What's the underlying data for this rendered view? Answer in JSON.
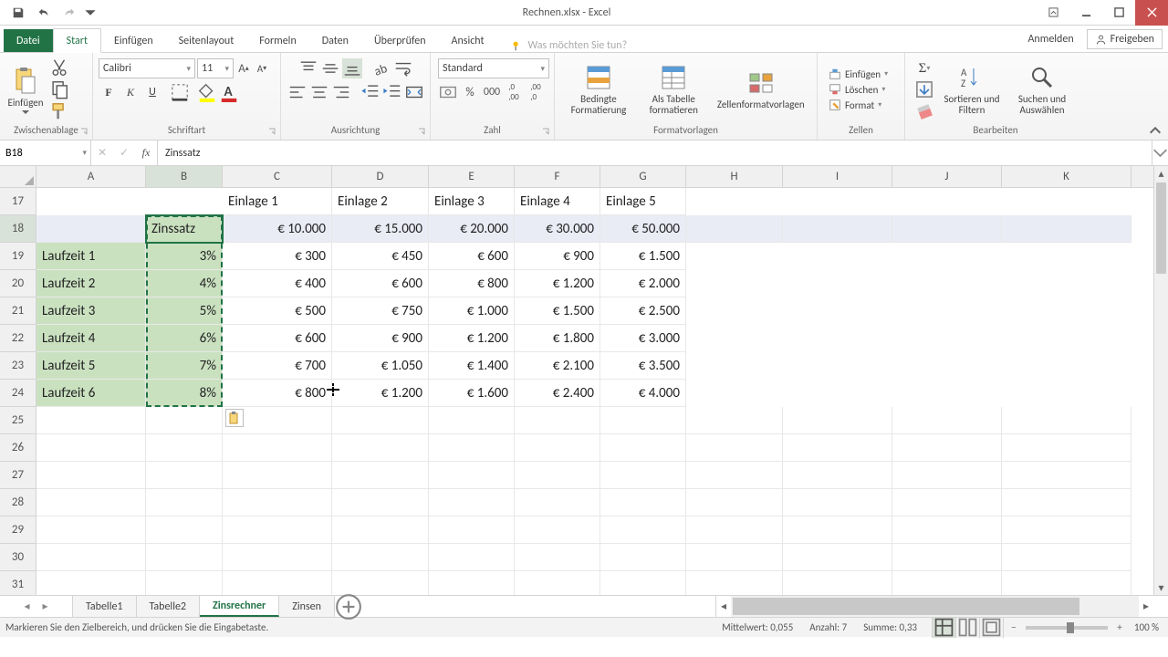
{
  "title": "Rechnen.xlsx - Excel",
  "ribbon_tabs": {
    "file": "Datei",
    "start": "Start",
    "einfuegen": "Einfügen",
    "seitenlayout": "Seitenlayout",
    "formeln": "Formeln",
    "daten": "Daten",
    "ueberpruefen": "Überprüfen",
    "ansicht": "Ansicht"
  },
  "tellme_placeholder": "Was möchten Sie tun?",
  "signin": "Anmelden",
  "share": "Freigeben",
  "groups": {
    "zwischenablage": "Zwischenablage",
    "schriftart": "Schriftart",
    "ausrichtung": "Ausrichtung",
    "zahl": "Zahl",
    "formatvorlagen": "Formatvorlagen",
    "zellen": "Zellen",
    "bearbeiten": "Bearbeiten"
  },
  "paste_label": "Einfügen",
  "font_name": "Calibri",
  "font_size": "11",
  "number_format": "Standard",
  "cond_format_label": "Bedingte Formatierung",
  "table_format_label": "Als Tabelle formatieren",
  "cell_styles_label": "Zellenformatvorlagen",
  "insert_label": "Einfügen",
  "delete_label": "Löschen",
  "format_label": "Format",
  "sort_filter_label": "Sortieren und Filtern",
  "find_select_label": "Suchen und Auswählen",
  "namebox": "B18",
  "formula": "Zinssatz",
  "columns": {
    "A": "A",
    "B": "B",
    "C": "C",
    "D": "D",
    "E": "E",
    "F": "F",
    "G": "G",
    "H": "H",
    "I": "I",
    "J": "J",
    "K": "K"
  },
  "col_widths": {
    "A": 120,
    "B": 84,
    "C": 120,
    "D": 106,
    "E": 94,
    "F": 94,
    "G": 94,
    "H": 106,
    "I": 120,
    "J": 120,
    "K": 142
  },
  "rows": [
    "17",
    "18",
    "19",
    "20",
    "21",
    "22",
    "23",
    "24",
    "25",
    "26",
    "27",
    "28",
    "29",
    "30",
    "31"
  ],
  "data": {
    "header_row": {
      "C": "Einlage 1",
      "D": "Einlage 2",
      "E": "Einlage 3",
      "F": "Einlage 4",
      "G": "Einlage 5"
    },
    "r18": {
      "B": "Zinssatz",
      "C": "€ 10.000",
      "D": "€ 15.000",
      "E": "€ 20.000",
      "F": "€ 30.000",
      "G": "€ 50.000"
    },
    "body": [
      {
        "A": "Laufzeit 1",
        "B": "3%",
        "C": "€ 300",
        "D": "€ 450",
        "E": "€ 600",
        "F": "€ 900",
        "G": "€ 1.500"
      },
      {
        "A": "Laufzeit 2",
        "B": "4%",
        "C": "€ 400",
        "D": "€ 600",
        "E": "€ 800",
        "F": "€ 1.200",
        "G": "€ 2.000"
      },
      {
        "A": "Laufzeit 3",
        "B": "5%",
        "C": "€ 500",
        "D": "€ 750",
        "E": "€ 1.000",
        "F": "€ 1.500",
        "G": "€ 2.500"
      },
      {
        "A": "Laufzeit 4",
        "B": "6%",
        "C": "€ 600",
        "D": "€ 900",
        "E": "€ 1.200",
        "F": "€ 1.800",
        "G": "€ 3.000"
      },
      {
        "A": "Laufzeit 5",
        "B": "7%",
        "C": "€ 700",
        "D": "€ 1.050",
        "E": "€ 1.400",
        "F": "€ 2.100",
        "G": "€ 3.500"
      },
      {
        "A": "Laufzeit 6",
        "B": "8%",
        "C": "€ 800",
        "D": "€ 1.200",
        "E": "€ 1.600",
        "F": "€ 2.400",
        "G": "€ 4.000"
      }
    ]
  },
  "sheet_tabs": [
    "Tabelle1",
    "Tabelle2",
    "Zinsrechner",
    "Zinsen"
  ],
  "active_sheet": 2,
  "status_msg": "Markieren Sie den Zielbereich, und drücken Sie die Eingabetaste.",
  "stats": {
    "mittelwert_l": "Mittelwert:",
    "mittelwert": "0,055",
    "anzahl_l": "Anzahl:",
    "anzahl": "7",
    "summe_l": "Summe:",
    "summe": "0,33"
  },
  "zoom": "100 %"
}
